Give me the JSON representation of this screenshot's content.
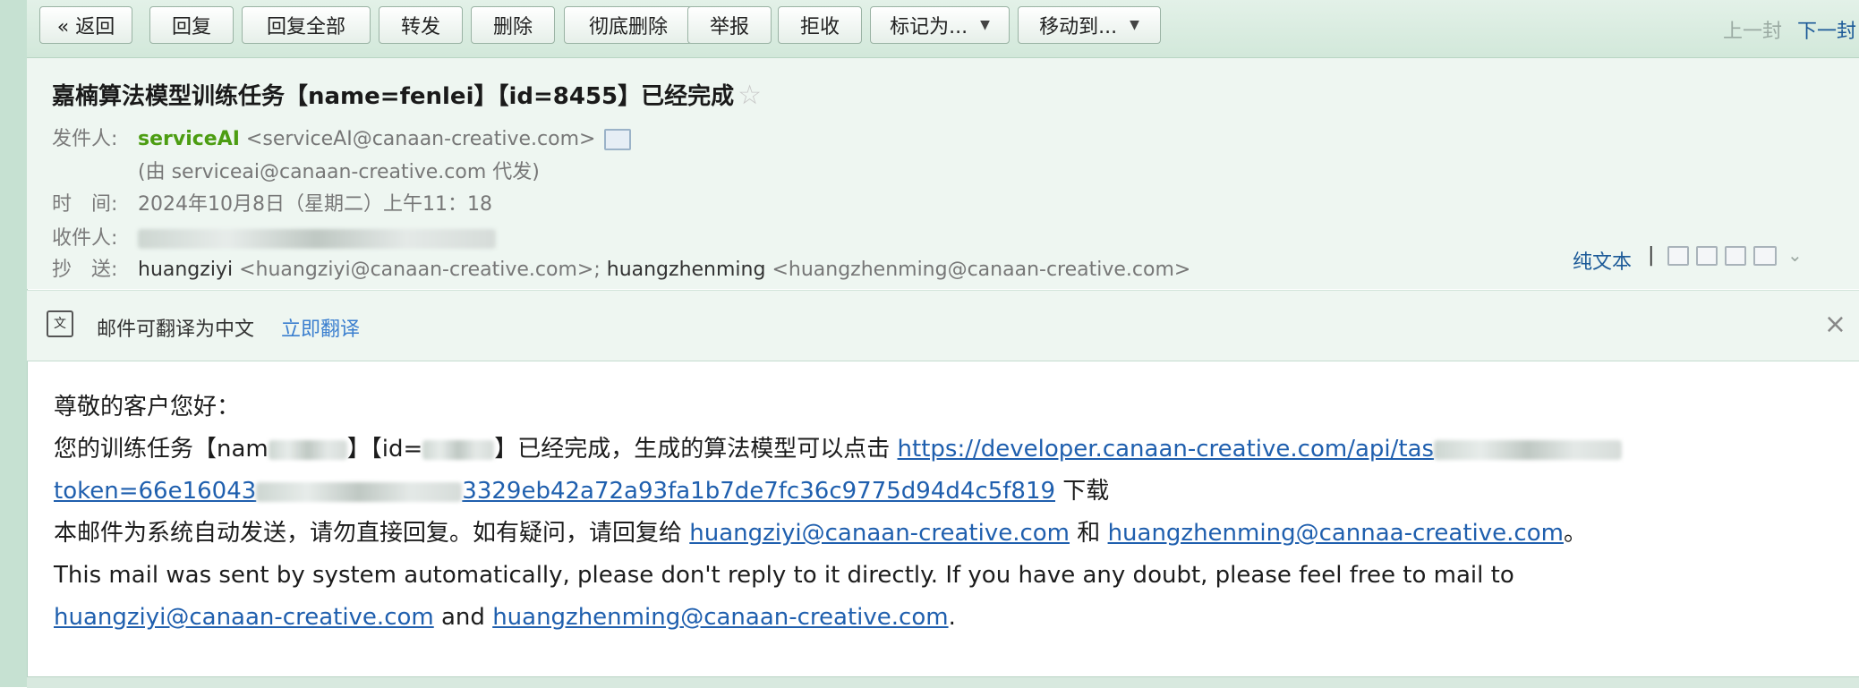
{
  "toolbar": {
    "back": "« 返回",
    "reply": "回复",
    "reply_all": "回复全部",
    "forward": "转发",
    "delete": "删除",
    "delete_forever": "彻底删除",
    "report": "举报",
    "reject": "拒收",
    "mark_as": "标记为...",
    "move_to": "移动到...",
    "prev": "上一封",
    "next": "下一封"
  },
  "header": {
    "subject": "嘉楠算法模型训练任务【name=fenlei】【id=8455】已经完成",
    "from_label": "发件人:",
    "from_name": "serviceAI",
    "from_email": "<serviceAI@canaan-creative.com>",
    "on_behalf": "(由 serviceai@canaan-creative.com 代发)",
    "time_label": "时　间:",
    "time_value": "2024年10月8日（星期二）上午11：18",
    "to_label": "收件人:",
    "cc_label": "抄　送:",
    "cc_name1": "huangziyi",
    "cc_email1": "<huangziyi@canaan-creative.com>;",
    "cc_name2": "huangzhenming",
    "cc_email2": "<huangzhenming@canaan-creative.com>",
    "plain_text": "纯文本",
    "divider": "|"
  },
  "translate": {
    "text": "邮件可翻译为中文",
    "action": "立即翻译",
    "close": "×"
  },
  "body": {
    "greeting": "尊敬的客户您好：",
    "line1_a": "您的训练任务【nam",
    "line1_b": "】【id=",
    "line1_c": "】已经完成，生成的算法模型可以点击",
    "link1_a": "https://developer.canaan-creative.com/api/tas",
    "link1_b": "token=66e16043",
    "link1_c": "3329eb42a72a93fa1b7de7fc36c9775d94d4c5f819",
    "download": "下载",
    "line3_a": "本邮件为系统自动发送，请勿直接回复。如有疑问，请回复给",
    "mail1": "huangziyi@canaan-creative.com",
    "and_cn": "和",
    "mail2": "huangzhenming@cannaa-creative.com",
    "period_cn": "。",
    "line4": "This mail was sent by system automatically, please don't reply to it directly. If you have any doubt, please feel free to mail to",
    "mail3": "huangziyi@canaan-creative.com",
    "and_en": "and",
    "mail4": "huangzhenming@canaan-creative.com",
    "period_en": "."
  }
}
